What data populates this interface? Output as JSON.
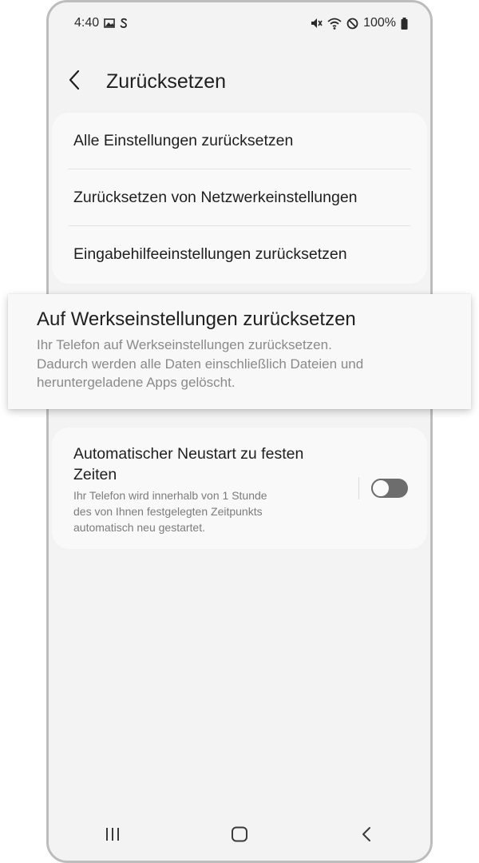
{
  "status_bar": {
    "time": "4:40",
    "battery": "100%",
    "left_icons": [
      "gallery-icon",
      "s-app-icon"
    ],
    "right_icons": [
      "mute-icon",
      "wifi-icon",
      "do-not-disturb-icon",
      "battery-icon"
    ]
  },
  "header": {
    "back_icon": "chevron-left-icon",
    "title": "Zurücksetzen"
  },
  "reset_options": [
    {
      "label": "Alle Einstellungen zurücksetzen"
    },
    {
      "label": "Zurücksetzen von Netzwerkeinstellungen"
    },
    {
      "label": "Eingabehilfeeinstellungen zurücksetzen"
    }
  ],
  "factory_reset": {
    "title": "Auf Werkseinstellungen zurücksetzen",
    "description_lines": [
      "Ihr Telefon auf Werkseinstellungen zurücksetzen.",
      "Dadurch werden alle Daten einschließlich Dateien und",
      "heruntergeladene Apps gelöscht."
    ]
  },
  "auto_restart": {
    "title_lines": [
      "Automatischer Neustart zu festen",
      "Zeiten"
    ],
    "description_lines": [
      "Ihr Telefon wird innerhalb von 1 Stunde",
      "des von Ihnen festgelegten Zeitpunkts",
      "automatisch neu gestartet."
    ],
    "toggle_state": "off"
  },
  "nav_bar": {
    "buttons": [
      "recent-apps-icon",
      "home-icon",
      "back-icon"
    ]
  },
  "colors": {
    "screen_background": "#f3f3f3",
    "card_background": "#f9f9f9",
    "toggle_off": "#6d6d6d",
    "secondary_text": "#7c7c7c"
  }
}
